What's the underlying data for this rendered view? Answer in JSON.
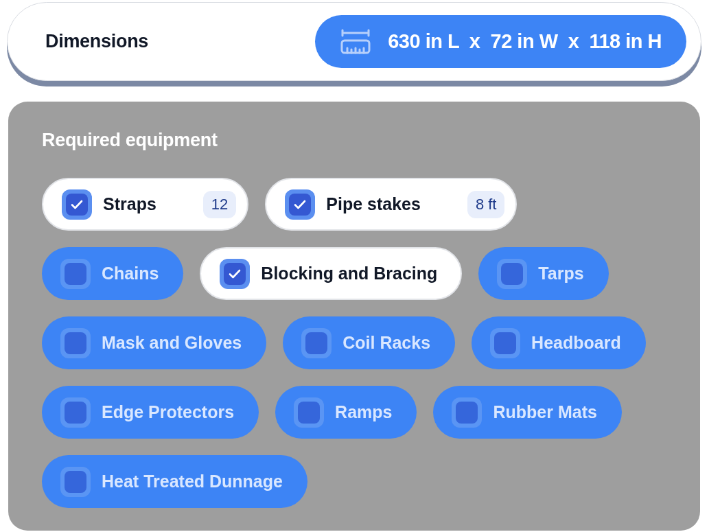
{
  "dimensions": {
    "label": "Dimensions",
    "value": "630 in L  x  72 in W  x  118 in H"
  },
  "equipment": {
    "title": "Required equipment",
    "items": [
      {
        "label": "Straps",
        "checked": true,
        "quantity": "12"
      },
      {
        "label": "Pipe stakes",
        "checked": true,
        "quantity": "8 ft"
      },
      {
        "label": "Chains",
        "checked": false
      },
      {
        "label": "Blocking and Bracing",
        "checked": true
      },
      {
        "label": "Tarps",
        "checked": false
      },
      {
        "label": "Mask and Gloves",
        "checked": false
      },
      {
        "label": "Coil Racks",
        "checked": false
      },
      {
        "label": "Headboard",
        "checked": false
      },
      {
        "label": "Edge Protectors",
        "checked": false
      },
      {
        "label": "Ramps",
        "checked": false
      },
      {
        "label": "Rubber Mats",
        "checked": false
      },
      {
        "label": "Heat Treated Dunnage",
        "checked": false
      }
    ]
  }
}
